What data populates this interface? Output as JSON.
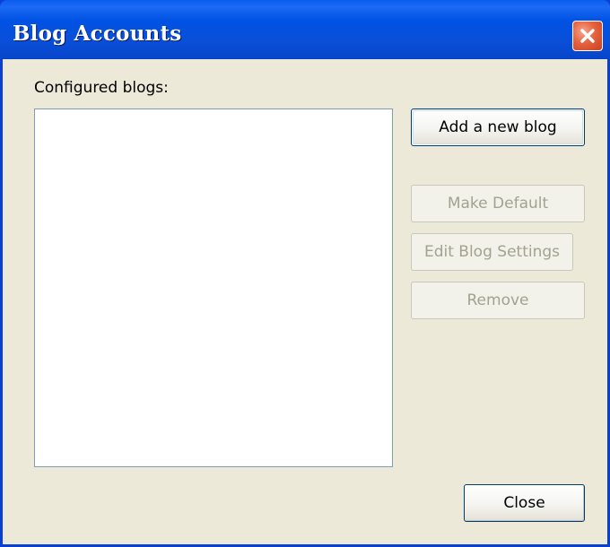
{
  "window": {
    "title": "Blog Accounts",
    "close_icon": "close-icon"
  },
  "dialog": {
    "list_label": "Configured blogs:",
    "blogs": [],
    "buttons": {
      "add_new_blog": "Add a new blog",
      "make_default": "Make Default",
      "edit_blog_settings": "Edit Blog Settings",
      "remove": "Remove",
      "close": "Close"
    },
    "button_states": {
      "add_new_blog": "enabled",
      "make_default": "disabled",
      "edit_blog_settings": "disabled",
      "remove": "disabled",
      "close": "enabled"
    }
  },
  "colors": {
    "titlebar": "#0a4fd9",
    "client_background": "#ece9d8",
    "close_button": "#e5623f",
    "disabled_text": "#a4a190"
  }
}
